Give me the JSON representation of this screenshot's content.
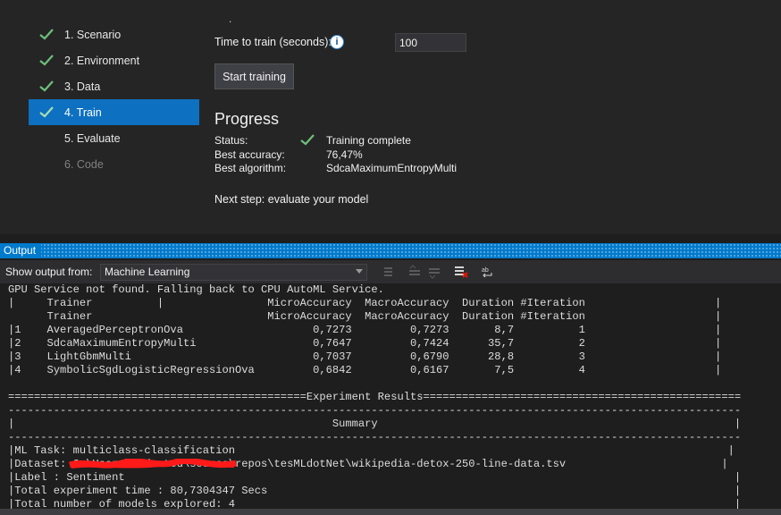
{
  "wizard": {
    "steps": [
      {
        "label": "1. Scenario",
        "state": "done"
      },
      {
        "label": "2. Environment",
        "state": "done"
      },
      {
        "label": "3. Data",
        "state": "done"
      },
      {
        "label": "4. Train",
        "state": "active"
      },
      {
        "label": "5. Evaluate",
        "state": "pending"
      },
      {
        "label": "6. Code",
        "state": "disabled"
      }
    ]
  },
  "train": {
    "time_label": "Time to train (seconds):",
    "time_value": "100",
    "info_icon": "info-icon",
    "start_button": "Start training"
  },
  "progress": {
    "heading": "Progress",
    "status_label": "Status:",
    "status_value": "Training complete",
    "accuracy_label": "Best accuracy:",
    "accuracy_value": "76,47%",
    "algorithm_label": "Best algorithm:",
    "algorithm_value": "SdcaMaximumEntropyMulti",
    "next_step": "Next step: evaluate your model"
  },
  "output_panel": {
    "title": "Output",
    "show_from_label": "Show output from:",
    "source": "Machine Learning",
    "lines": [
      "GPU Service not found. Falling back to CPU AutoML Service.",
      "|     Trainer          |                MicroAccuracy  MacroAccuracy  Duration #Iteration                    |",
      "      Trainer                           MicroAccuracy  MacroAccuracy  Duration #Iteration                    |",
      "|1    AveragedPerceptronOva                    0,7273         0,7273       8,7          1                    |",
      "|2    SdcaMaximumEntropyMulti                  0,7647         0,7424      35,7          2                    |",
      "|3    LightGbmMulti                            0,7037         0,6790      28,8          3                    |",
      "|4    SymbolicSgdLogisticRegressionOva         0,6842         0,6167       7,5          4                    |",
      "",
      "==============================================Experiment Results=================================================",
      "-----------------------------------------------------------------------------------------------------------------",
      "|                                                 Summary                                                       |",
      "-----------------------------------------------------------------------------------------------------------------",
      "|ML Task: multiclass-classification                                                                            |",
      "|Dataset: C:\\Users\\redacted\\source\\repos\\tesMLdotNet\\wikipedia-detox-250-line-data.tsv                        |",
      "|Label : Sentiment                                                                                              |",
      "|Total experiment time : 80,7304347 Secs                                                                        |",
      "|Total number of models explored: 4                                                                             |"
    ]
  },
  "colors": {
    "accent": "#007acc",
    "active_step": "#0e70c0",
    "check": "#6fc07a",
    "redaction": "#ff1a1a"
  }
}
